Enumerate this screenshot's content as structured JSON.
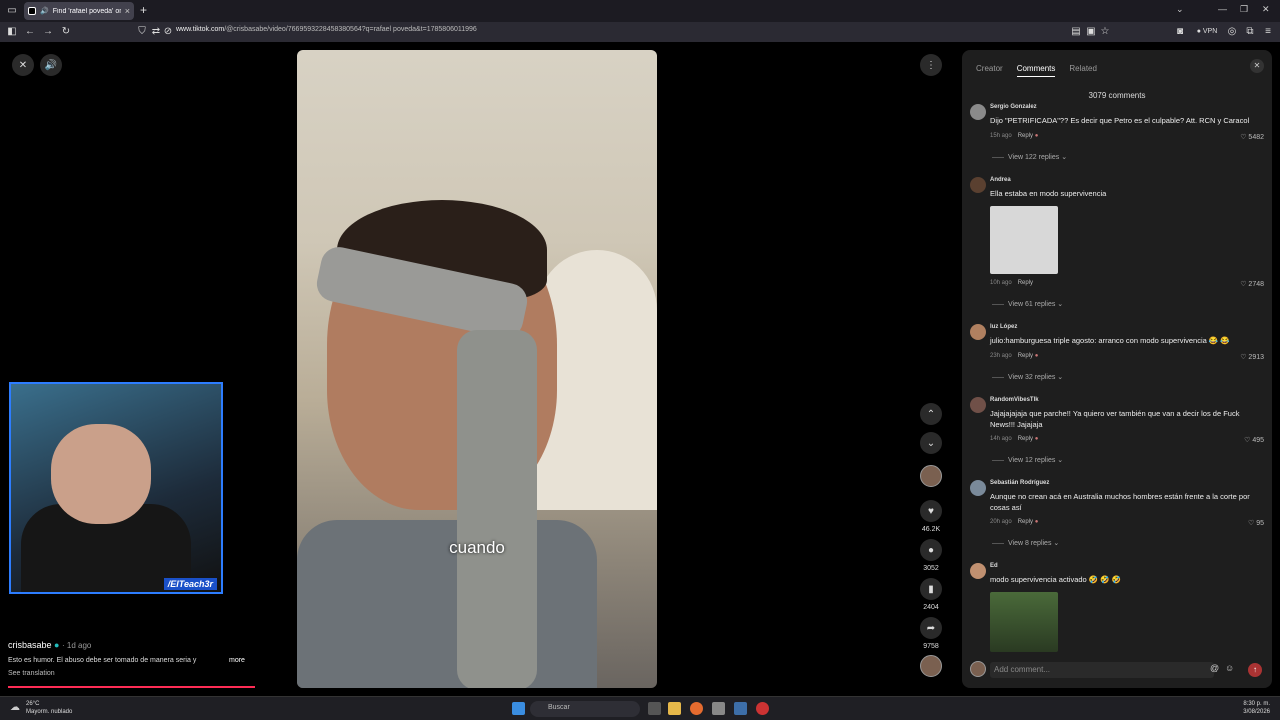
{
  "browser": {
    "tab_title": "Find 'rafael poveda' on TikTok",
    "url_domain": "www.tiktok.com",
    "url_rest": "/@crisbasabe/video/7669593228458380564?q=rafael poveda&t=1785806011996",
    "vpn_label": "VPN"
  },
  "video": {
    "caption": "cuando",
    "likes": "46.2K",
    "comments": "3052",
    "saves": "2404",
    "shares": "9758",
    "author": "crisbasabe",
    "ago": "· 1d ago",
    "description": "Esto es humor. El abuso debe ser tomado de manera seria y",
    "more": "more",
    "see_translation": "See translation",
    "progress": 0.2
  },
  "webcam": {
    "tag": "/ElTeach3r"
  },
  "panel": {
    "tabs": [
      "Creator",
      "Comments",
      "Related"
    ],
    "count": "3079 comments",
    "add_placeholder": "Add comment...",
    "comments": [
      {
        "name": "Sergio Gonzalez",
        "text": "Dijo \"PETRIFICADA\"?? Es decir que Petro es el culpable? Att. RCN y Caracol",
        "time": "15h ago",
        "reply": "Reply",
        "likes": "5482",
        "replies": "View 122 replies"
      },
      {
        "name": "Andrea",
        "text": "Ella estaba en modo supervivencia",
        "time": "10h ago",
        "reply": "Reply",
        "likes": "2748",
        "replies": "View 61 replies"
      },
      {
        "name": "luz López",
        "text": "julio:hamburguesa triple agosto: arranco con modo supervivencia 😂 😂",
        "time": "23h ago",
        "reply": "Reply",
        "likes": "2913",
        "replies": "View 32 replies"
      },
      {
        "name": "RandomVibesTlk",
        "text": "Jajajajajaja que parche!! Ya quiero ver también que van a decir los de Fuck News!!! Jajajaja",
        "time": "14h ago",
        "reply": "Reply",
        "likes": "495",
        "replies": "View 12 replies"
      },
      {
        "name": "Sebastián Rodríguez",
        "text": "Aunque no crean acá en Australia muchos hombres están frente a la corte por cosas así",
        "time": "20h ago",
        "reply": "Reply",
        "likes": "95",
        "replies": "View 8 replies"
      },
      {
        "name": "Ed",
        "text": "modo supervivencia activado 🤣 🤣 🤣",
        "time": "",
        "reply": "",
        "likes": "",
        "replies": ""
      }
    ]
  },
  "taskbar": {
    "temp": "26°C",
    "weather": "Mayorm. nublado",
    "search": "Buscar",
    "time": "8:30 p. m.",
    "date": "3/08/2026"
  }
}
